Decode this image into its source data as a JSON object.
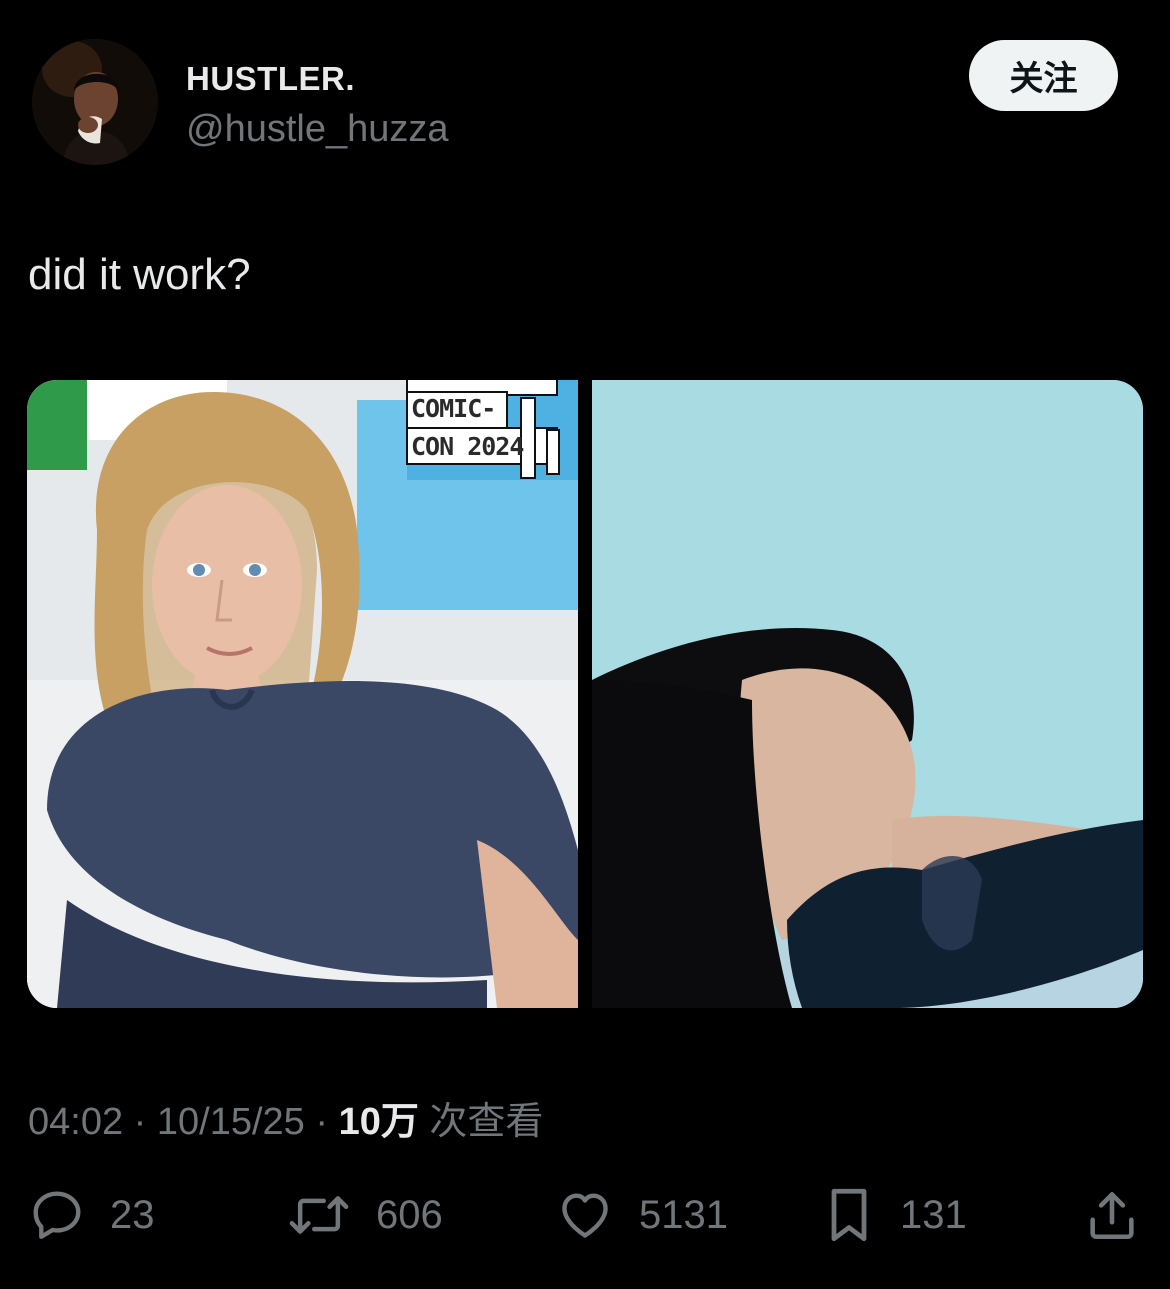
{
  "author": {
    "display_name": "HUSTLER.",
    "handle": "@hustle_huzza",
    "avatar_icon": "avatar-photo"
  },
  "follow_button": {
    "label": "关注"
  },
  "tweet": {
    "text": "did it work?"
  },
  "media": {
    "left_photo_sign_lines": [
      "COMIC-",
      "CON 2024"
    ]
  },
  "meta": {
    "time": "04:02",
    "separator": " · ",
    "date": "10/15/25",
    "views_count": "10万",
    "views_label": " 次查看"
  },
  "actions": {
    "reply": {
      "icon": "reply-icon",
      "count": "23"
    },
    "retweet": {
      "icon": "retweet-icon",
      "count": "606"
    },
    "like": {
      "icon": "heart-icon",
      "count": "5131"
    },
    "bookmark": {
      "icon": "bookmark-icon",
      "count": "131"
    },
    "share": {
      "icon": "share-icon"
    }
  },
  "colors": {
    "background": "#000000",
    "primary_text": "#e7e9ea",
    "secondary_text": "#71767b",
    "follow_button_bg": "#eff3f4"
  }
}
